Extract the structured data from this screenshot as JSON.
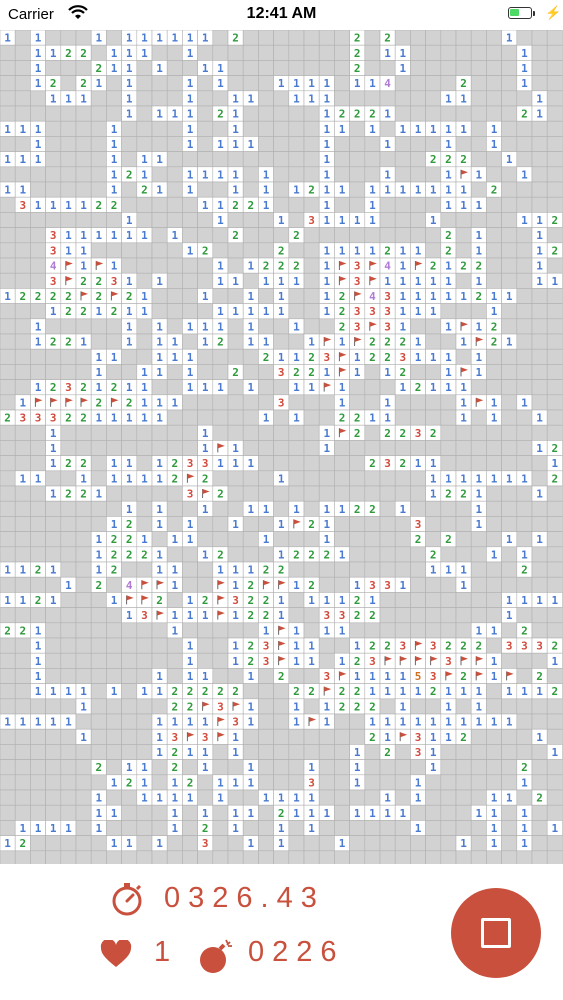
{
  "status_bar": {
    "carrier": "Carrier",
    "time": "12:41 AM"
  },
  "hud": {
    "timer": "0326.43",
    "lives": "1",
    "mines": "0226",
    "icons": {
      "timer": "stopwatch-icon",
      "lives": "heart-icon",
      "mines": "bomb-icon",
      "stop": "stop-icon"
    }
  },
  "colors": {
    "accent": "#c8503c",
    "hidden_cell": "#d2d2d2",
    "revealed_cell": "#ffffff",
    "grid_line": "#b0b0b0",
    "n1": "#4a7ad0",
    "n2": "#2f9a3c",
    "n3": "#d24a3c",
    "n4": "#b07ad6",
    "n5": "#d07020",
    "flag": "#c8503c"
  },
  "board": {
    "cols": 37,
    "rows": 55,
    "legend": "H=hidden, 0=empty revealed, 1-5=numbers, F=flag",
    "rows_data": [
      "1H1HHH1H111111H2HHHHHHH2H2HHHHHHH1HHH",
      "HH1122H111HH1HHHHHHHHHH2H11HHHHHHH1HH",
      "HH1HHH211H1HH11HHHHHHHH2HH1HHHHHHH1HH",
      "HH12H21H1HHH1H1HHH1111H114HHHH2HHH1HH",
      "HHH111HH1HHH1HH11HH111HHHHHHH11HHHH1H",
      "HHHHHHHH1H111H21HHHHH12221HHHHHHHH21H",
      "111HHHH1HHHH1HH1HHHHH11H1H11111H1HHHH",
      "HH1HHHH1HHHH1H111HHHH1HHH1HHH1HH1HHHH",
      "111HHHH1H11HHHHHHHHHH1HHHHHH222HH1HHH",
      "HHHHHHH121HH1111H1HHH1HHH1HHH1F1HH1HH",
      "11HHHHH1H21H1HH1H1H1211H1111111H2HHHH",
      "H3111122HHHHH11221HHH1HH1HHHH111HHHHH",
      "HHHHHHHH1HHHHH1HHH1H31111HHH1HHHHH112",
      "HHH3111111H1HHH2HHH2HHHHHHHHH2H1HHH1H",
      "HHH311HHHHHH12HHHH2HH1111211H2H1HHH12",
      "HHH4F1F1HHHHHH1H1222H1F3F41F2122HHH1H",
      "HHH3F2231H1HHH11H111H1F3F11111H1HHH11",
      "12222F2F21HHH1HH1H1HH12F4311111211HHH",
      "HHH1221211HHHH11111HH12333111HHH1HHHH",
      "HH1HHHHH1H1H111H1HH1HH23F31HH1F12HHHH",
      "HH1221HH1H11H12H11HH1F1F2221HH1F21HHH",
      "HHHHHH11HH111HHHH21123F1223111H1HHHHH",
      "HHHHHH1HH11H1HH2HH3221F1H12HH1F1HHHHH",
      "HH12321211HH111H1HH11F1HHH12111HHHHHH",
      "H1FFFF2F2111HHHHHH3HHH1HH1HHHH1F1H1HH",
      "23332211111HHHHHH1H1HH2211HHHH1H1HH1H",
      "HHH1HHHHHHHHH1HHHHHHH1F2H2232HHHHHHHH",
      "HHH1HHHHHHHHH1F1HHHHH1HHHHHHHHHHHHH12",
      "HHH122H11H1233111HHHHHHH23211HHHHHHH1",
      "H11HH1H11112F2HHHH1HHHHHHHHH1111111H2",
      "HHH1221HHHHH3F2HHHHHHHHHHHHH1221HHH1H",
      "HHHHHHHH1H1HH1HH11H1H1122H1HHHH1HHHHH",
      "HHHHHHH12H1H1HH1HH1F21HHHHH3HHH1HHHHH",
      "HHHHHH1221H11HHHH1HHH1HHHHH2H2HHH1H1H",
      "HHHHHH12221HH12HHH12221HHHHH2HHH1H1HH",
      "1121HH12HH11HH11122HHHHHHHHH111HHH2HH",
      "HHHH1H2H4FF1HHF12FF12HH1331HHH1HHHHHH",
      "1121HHH1FF2H12F3221H11121HHHHHHHH1111",
      "HHHHHHHH13F111F1221HH3322HHHHHHHH1HHH",
      "221HHHHHHHH1HHHHH1F1H11HHHHHHHH11H2HH",
      "HH1HHHHHHHHH1HH123F11HH1223F3222H3332",
      "HH1HHHHHHHHH1HH123F11H123FFFF3FF1HHH1",
      "HH1HHHHHHH1H11HH1H2HH3F111153F2F1FH2H",
      "HH1111H1H1122222HHH22F2211112111H1112",
      "HHHHH1HHHHH22F3F1HH1H1222H1HH1H1HHHHH",
      "11111HHHHH1111F31HH1F1HH1111111111HHH",
      "HHHHH1HHHH13F3F1HHHHHHHH21F3112HHHH1H",
      "HHHHHHHHHH1211H1HHHHHHH1H2H31HHHHHHH1",
      "HHHHHH2H11H2H1HH1HHH1HH1HHHH1HHHHH2HH",
      "HHHHHHH121H12H111HHH3HH1HHH1HHHHHH1HH",
      "HHHHHH1HH1111H1HH1111HHHH1H1HHHH11H2H",
      "HHHHHH11HHH1H1H11H2111H1111HHHH11H1HH",
      "H1111H1HHHH1H2H1HH1H1HHHHHH1HHHH1H1H1",
      "12HHHHH11H1HH3HH1H1HHH1HHHHHHH1H1H1HH",
      "HHHHHHHHHHHHHHHHHHHHHHHHHHHHHHHHHHHHH"
    ]
  }
}
